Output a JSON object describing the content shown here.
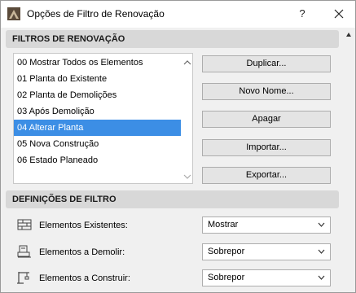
{
  "window": {
    "title": "Opções de Filtro de Renovação",
    "help_label": "?"
  },
  "renovation_filters": {
    "header": "FILTROS DE RENOVAÇÃO",
    "items": [
      {
        "label": "00 Mostrar Todos os Elementos",
        "selected": false
      },
      {
        "label": "01 Planta do Existente",
        "selected": false
      },
      {
        "label": "02 Planta de Demolições",
        "selected": false
      },
      {
        "label": "03 Após Demolição",
        "selected": false
      },
      {
        "label": "04 Alterar Planta",
        "selected": true
      },
      {
        "label": "05 Nova Construção",
        "selected": false
      },
      {
        "label": "06 Estado Planeado",
        "selected": false
      }
    ],
    "buttons": {
      "duplicate": "Duplicar...",
      "new_name": "Novo Nome...",
      "delete": "Apagar",
      "import": "Importar...",
      "export": "Exportar..."
    }
  },
  "filter_settings": {
    "header": "DEFINIÇÕES DE FILTRO",
    "rows": [
      {
        "label": "Elementos Existentes:",
        "value": "Mostrar",
        "icon": "existing-elements-icon"
      },
      {
        "label": "Elementos a Demolir:",
        "value": "Sobrepor",
        "icon": "demolish-elements-icon"
      },
      {
        "label": "Elementos a Construir:",
        "value": "Sobrepor",
        "icon": "construct-elements-icon"
      }
    ]
  },
  "colors": {
    "selection": "#3c8ee5",
    "header_bg": "#d8d8d8",
    "window_bg": "#f0f0f0"
  }
}
